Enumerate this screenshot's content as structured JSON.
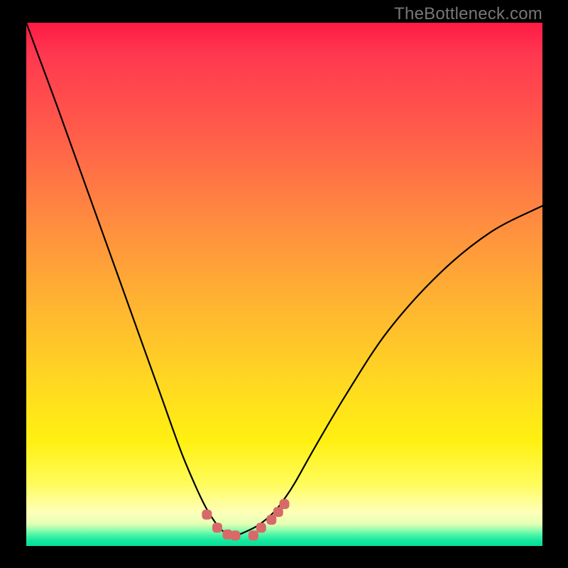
{
  "watermark": "TheBottleneck.com",
  "colors": {
    "frame": "#000000",
    "watermark_text": "#777777",
    "curve_stroke": "#000000",
    "marker_fill": "#d76a68",
    "gradient_top": "#ff1a44",
    "gradient_bottom": "#05e19b"
  },
  "chart_data": {
    "type": "line",
    "title": "",
    "xlabel": "",
    "ylabel": "",
    "xlim": [
      0,
      100
    ],
    "ylim": [
      0,
      100
    ],
    "x": [
      0,
      3,
      6,
      10,
      14,
      18,
      22,
      26,
      30,
      33,
      35,
      37,
      38.5,
      39.5,
      40.5,
      42,
      45,
      48,
      50,
      52,
      56,
      62,
      70,
      80,
      90,
      100
    ],
    "y": [
      100,
      92,
      84,
      73,
      62,
      51,
      40,
      29,
      18,
      11,
      7,
      4,
      2.5,
      2,
      2,
      2.5,
      4,
      6.5,
      9,
      12,
      19,
      29,
      41,
      52,
      60,
      65
    ],
    "annotations": "V-shaped curve descending steeply from top-left, reaching a flat minimum near x≈40, then rising with diminishing slope toward the right edge.",
    "markers": {
      "shape": "rounded-square",
      "color": "#d76a68",
      "points_x": [
        35.0,
        37.0,
        39.0,
        40.5,
        44.0,
        45.5,
        47.5,
        48.8,
        50.0
      ],
      "points_y": [
        6.0,
        3.5,
        2.2,
        2.0,
        2.0,
        3.5,
        5.0,
        6.5,
        8.0
      ]
    }
  }
}
